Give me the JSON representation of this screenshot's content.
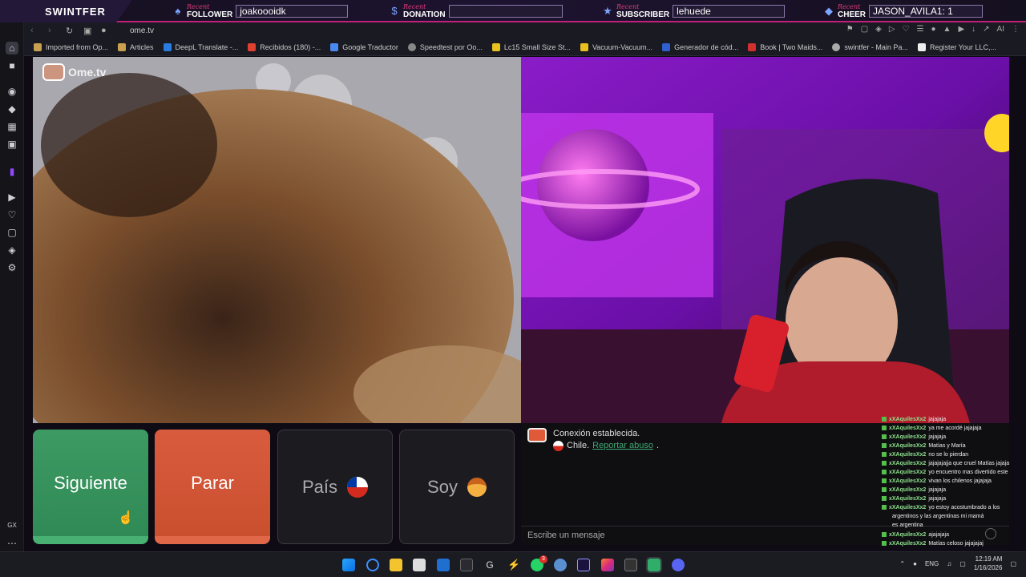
{
  "overlay": {
    "brand": "SWINTFER",
    "follower": {
      "recent": "Recent",
      "kind": "FOLLOWER",
      "value": "joakoooidk"
    },
    "donation": {
      "recent": "Recent",
      "kind": "DONATION",
      "value": ""
    },
    "subscriber": {
      "recent": "Recent",
      "kind": "SUBSCRIBER",
      "value": "lehuede"
    },
    "cheer": {
      "recent": "Recent",
      "kind": "CHEER",
      "value": "JASON_AVILA1: 1"
    }
  },
  "browser": {
    "url": "ome.tv",
    "bookmarks": [
      "Imported from Op...",
      "Articles",
      "DeepL Translate -...",
      "Recibidos (180) -...",
      "Google Traductor",
      "Speedtest por Oo...",
      "Lc15 Small Size St...",
      "Vacuum-Vacuum...",
      "Generador de cód...",
      "Book | Two Maids...",
      "swintfer - Main Pa...",
      "Register Your LLC,..."
    ],
    "ai_label": "AI",
    "sidebar_bottom_label": "GX"
  },
  "ometv": {
    "logo": "Ome.tv",
    "buttons": {
      "next": "Siguiente",
      "stop": "Parar",
      "country": "País",
      "gender": "Soy"
    },
    "chat": {
      "connected": "Conexión establecida.",
      "country": "Chile.",
      "report": "Reportar abuso",
      "placeholder": "Escribe un mensaje"
    }
  },
  "stream_chat": [
    {
      "user": "xXAquilesXx2",
      "msg": "jajajaja"
    },
    {
      "user": "xXAquilesXx2",
      "msg": "ya me acordé jajajaja"
    },
    {
      "user": "xXAquilesXx2",
      "msg": "jajajaja"
    },
    {
      "user": "xXAquilesXx2",
      "msg": "Matías y María"
    },
    {
      "user": "xXAquilesXx2",
      "msg": "no se lo pierdan"
    },
    {
      "user": "xXAquilesXx2",
      "msg": "jajajajajja que cruel Matías jajaja"
    },
    {
      "user": "xXAquilesXx2",
      "msg": "yo encuentro mas divertido este"
    },
    {
      "user": "xXAquilesXx2",
      "msg": "vivan los chilenos jajajaja"
    },
    {
      "user": "xXAquilesXx2",
      "msg": "jajajaja"
    },
    {
      "user": "xXAquilesXx2",
      "msg": "jajajaja"
    },
    {
      "user": "xXAquilesXx2",
      "msg": "yo estoy acostumbrado a los"
    },
    {
      "user": "",
      "msg": "argentinos y las argentinas mi mamá"
    },
    {
      "user": "",
      "msg": "es argentina"
    },
    {
      "user": "xXAquilesXx2",
      "msg": "ajajajaja"
    },
    {
      "user": "xXAquilesXx2",
      "msg": "Matías celoso jajajajaj"
    }
  ],
  "taskbar": {
    "language": "ENG",
    "time": "12:19 AM",
    "date": "1/16/2026",
    "whatsapp_badge": "3"
  }
}
